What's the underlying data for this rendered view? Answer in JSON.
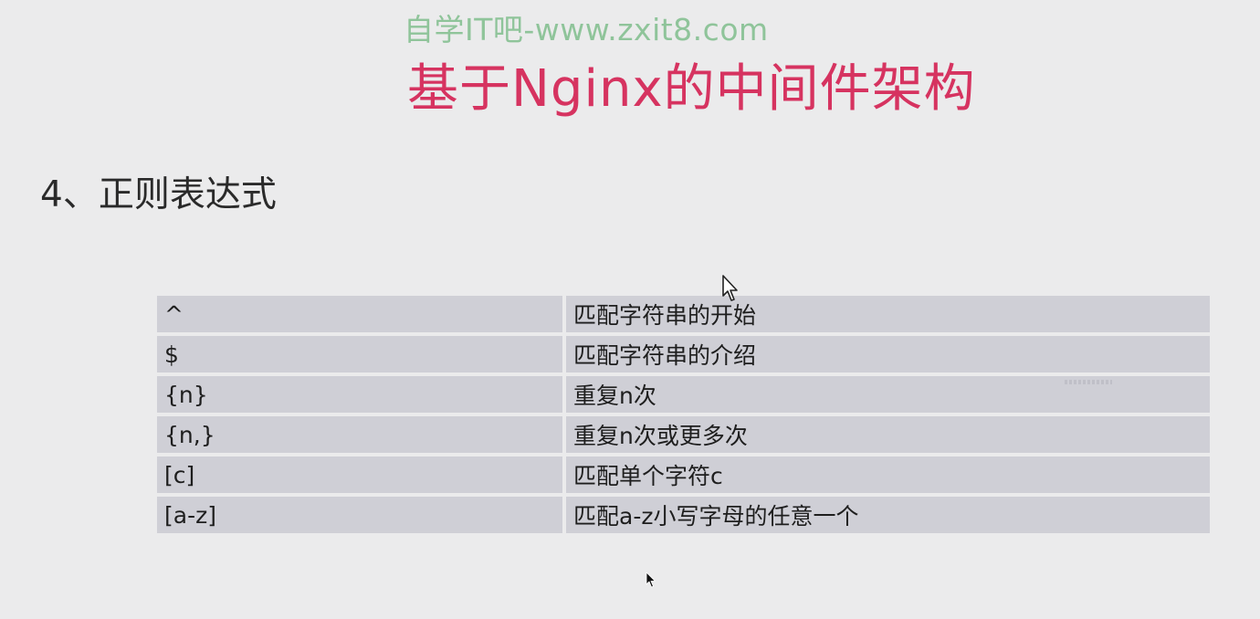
{
  "watermark": "自学IT吧-www.zxit8.com",
  "slide": {
    "title": "基于Nginx的中间件架构",
    "section_heading": "4、正则表达式"
  },
  "regex_table": {
    "rows": [
      {
        "pattern": "^",
        "description": "匹配字符串的开始"
      },
      {
        "pattern": "$",
        "description": "匹配字符串的介绍"
      },
      {
        "pattern": "{n}",
        "description": "重复n次"
      },
      {
        "pattern": "{n,}",
        "description": "重复n次或更多次"
      },
      {
        "pattern": "[c]",
        "description": "匹配单个字符c"
      },
      {
        "pattern": "[a-z]",
        "description": "匹配a-z小写字母的任意一个"
      }
    ]
  },
  "icons": {
    "cursor_1": "mouse-pointer-icon",
    "cursor_2": "mouse-pointer-icon"
  },
  "colors": {
    "background": "#ebebec",
    "title": "#d63360",
    "watermark": "#8fc49a",
    "table_row": "#cfcfd6"
  }
}
